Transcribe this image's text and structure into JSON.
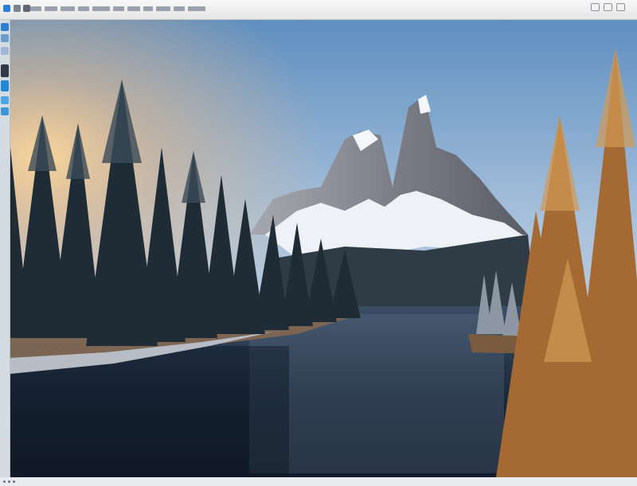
{
  "colors": {
    "toolbar_bg": "#ececec",
    "accent_blue": "#2a7fd4",
    "sky_top": "#6b9ec9",
    "sky_warm": "#f4c27a",
    "water": "#1e2c3e",
    "golden_tree": "#b8793a"
  },
  "toolbar": {
    "icons": [
      "app-icon",
      "back-icon"
    ],
    "menu_count_note": "",
    "window_buttons": [
      "minimize-icon",
      "restore-icon",
      "close-icon"
    ]
  },
  "side_strip": {
    "icons": [
      "tool-icon",
      "layers-icon",
      "user-icon",
      "panel-icon"
    ]
  },
  "canvas": {
    "image_subject": ""
  }
}
